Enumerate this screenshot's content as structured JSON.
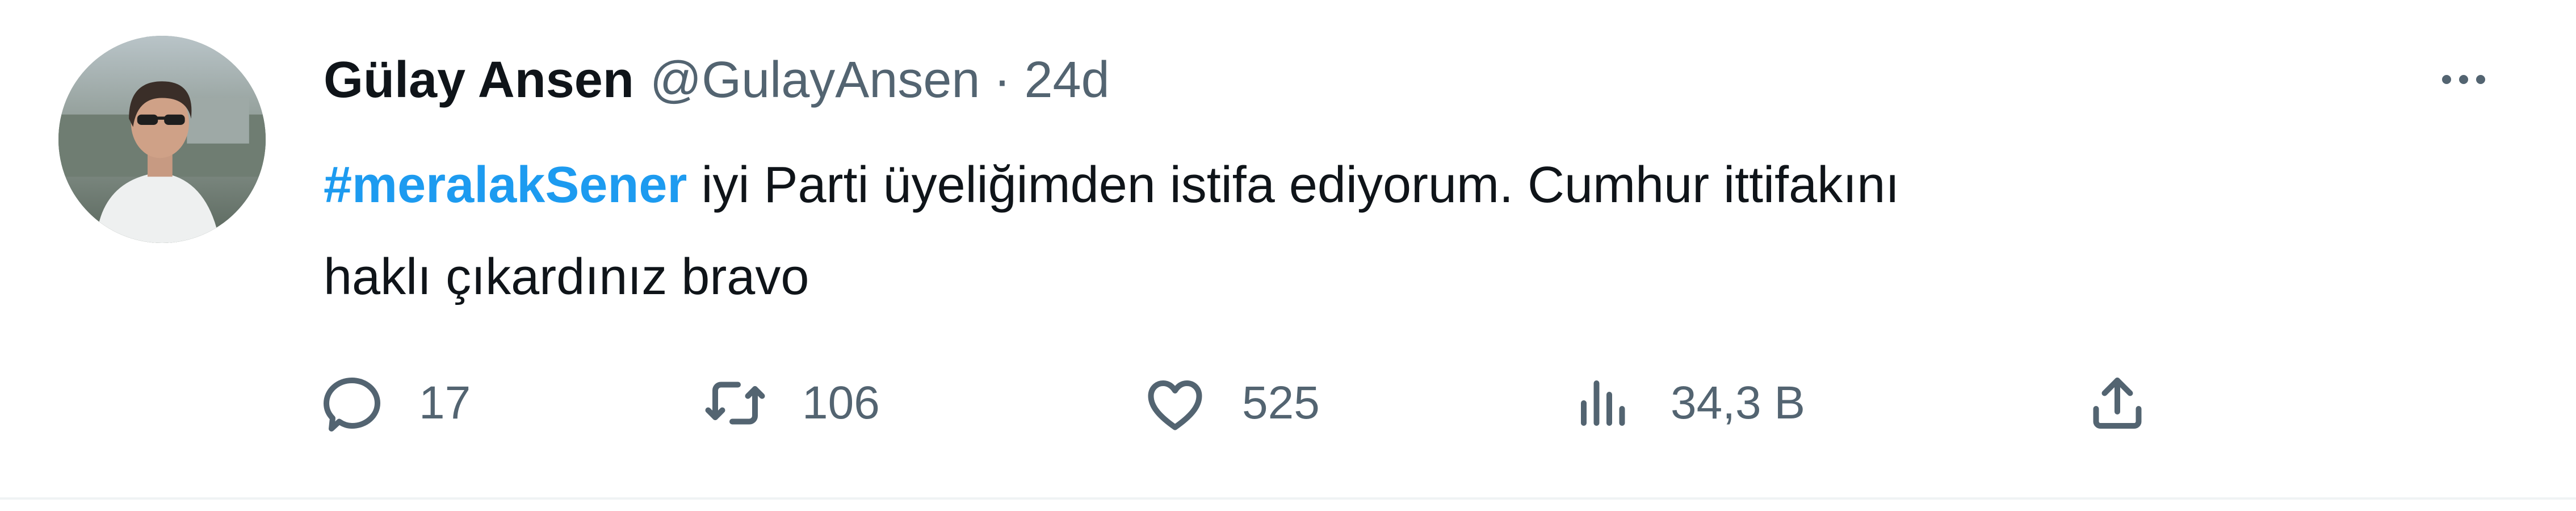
{
  "tweet": {
    "author_name": "Gülay Ansen",
    "handle": "@GulayAnsen",
    "separator": "·",
    "time": "24d",
    "hashtag": "#meralakSener",
    "text_line1": " iyi Parti üyeliğimden istifa ediyorum. Cumhur ittifakını",
    "text_line2": "haklı çıkardınız bravo",
    "avatar_icon": "avatar-photo",
    "more_icon": "more-dots-icon"
  },
  "actions": {
    "replies": "17",
    "retweets": "106",
    "likes": "525",
    "views": "34,3 B",
    "icons": [
      "reply-icon",
      "retweet-icon",
      "like-icon",
      "views-icon",
      "share-icon"
    ]
  },
  "colors": {
    "text": "#0f1419",
    "secondary": "#536471",
    "link": "#1d9bf0",
    "divider": "#eff3f4"
  }
}
